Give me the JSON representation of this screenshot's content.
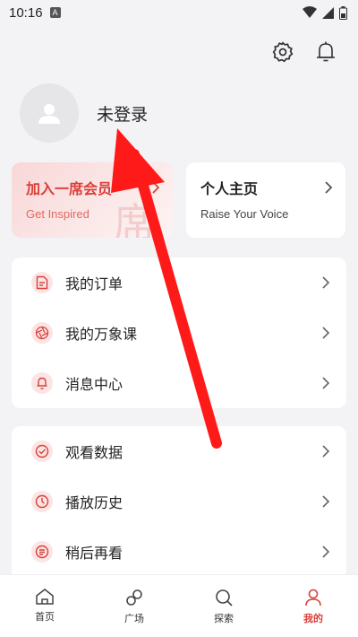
{
  "status": {
    "time": "10:16",
    "notif_letter": "A"
  },
  "profile": {
    "login_text": "未登录"
  },
  "cards": {
    "vip": {
      "title": "加入一席会员",
      "subtitle": "Get Inspired",
      "watermark": "席"
    },
    "home": {
      "title": "个人主页",
      "subtitle": "Raise Your Voice"
    }
  },
  "menu_group_1": [
    {
      "label": "我的订单",
      "icon": "order-icon"
    },
    {
      "label": "我的万象课",
      "icon": "aperture-icon"
    },
    {
      "label": "消息中心",
      "icon": "bell-icon"
    }
  ],
  "menu_group_2": [
    {
      "label": "观看数据",
      "icon": "check-circle-icon"
    },
    {
      "label": "播放历史",
      "icon": "clock-icon"
    },
    {
      "label": "稍后再看",
      "icon": "list-icon"
    }
  ],
  "tabs": [
    {
      "label": "首页",
      "icon": "home-icon",
      "active": false
    },
    {
      "label": "广场",
      "icon": "link-icon",
      "active": false
    },
    {
      "label": "探索",
      "icon": "search-icon",
      "active": false
    },
    {
      "label": "我的",
      "icon": "person-icon",
      "active": true
    }
  ],
  "colors": {
    "accent": "#d9403a",
    "background": "#f3f3f5",
    "annotation_arrow": "#ff1a1a"
  }
}
